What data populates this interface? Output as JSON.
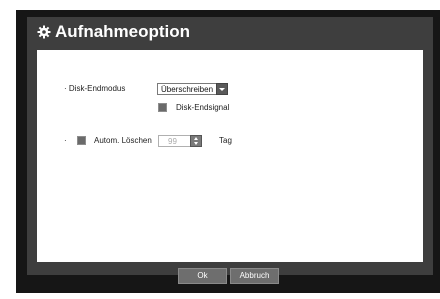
{
  "dialog": {
    "title": "Aufnahmeoption",
    "title_icon": "gear-icon"
  },
  "settings": {
    "disk_end_mode": {
      "label": "· Disk-Endmodus",
      "selected": "Überschreiben"
    },
    "disk_end_signal": {
      "label": "Disk-Endsignal",
      "checked": false
    },
    "auto_delete": {
      "bullet": "·",
      "label": "Autom. Löschen",
      "checked": false,
      "value": "99",
      "unit": "Tag"
    }
  },
  "footer": {
    "ok_label": "Ok",
    "cancel_label": "Abbruch"
  },
  "colors": {
    "frame": "#3e3e3e",
    "outer": "#161616",
    "panel": "#ffffff",
    "button": "#6e6e6e"
  }
}
